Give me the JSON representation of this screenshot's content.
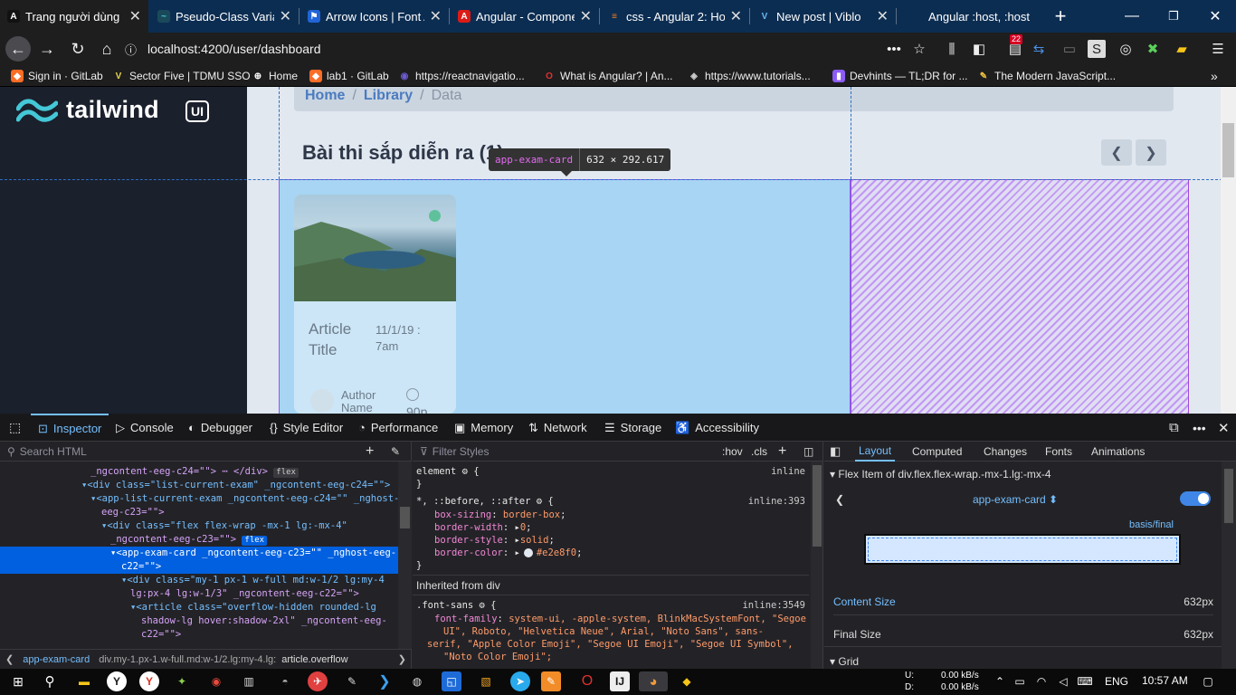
{
  "browser": {
    "tabs": [
      {
        "label": "Trang người dùng",
        "icon": "A",
        "icon_bg": "#111",
        "icon_fg": "#fff",
        "active": true
      },
      {
        "label": "Pseudo-Class Variar",
        "icon": "~",
        "icon_bg": "#1a4a5a",
        "icon_fg": "#44c7d6"
      },
      {
        "label": "Arrow Icons | Font A",
        "icon": "⚑",
        "icon_bg": "#2064d8",
        "icon_fg": "#fff"
      },
      {
        "label": "Angular - Compone",
        "icon": "A",
        "icon_bg": "#dd1b16",
        "icon_fg": "#fff"
      },
      {
        "label": "css - Angular 2: Hov",
        "icon": "≡",
        "icon_bg": "#0c2d52",
        "icon_fg": "#f48024"
      },
      {
        "label": "New post | Viblo",
        "icon": "V",
        "icon_bg": "#0c2d52",
        "icon_fg": "#68b8f0"
      },
      {
        "label": "Angular :host, :host",
        "icon": "",
        "icon_bg": "#0c2d52",
        "icon_fg": "#fff"
      }
    ],
    "url": "localhost:4200/user/dashboard",
    "notif_count": "22",
    "bookmarks": [
      {
        "label": "Sign in · GitLab",
        "color": "#fc6d26"
      },
      {
        "label": "Sector Five | TDMU SSO",
        "color": "#e8d44d"
      },
      {
        "label": "Home",
        "color": "#ffffff"
      },
      {
        "label": "lab1 · GitLab",
        "color": "#fc6d26"
      },
      {
        "label": "https://reactnavigatio...",
        "color": "#6b5bd6"
      },
      {
        "label": "What is Angular? | An...",
        "color": "#e03030"
      },
      {
        "label": "https://www.tutorials...",
        "color": "#cccccc"
      },
      {
        "label": "Devhints — TL;DR for ...",
        "color": "#8b5cf6"
      },
      {
        "label": "The Modern JavaScript...",
        "color": "#f0c040"
      }
    ]
  },
  "page": {
    "logo": "tailwind",
    "logo_badge": "UI",
    "breadcrumb": {
      "home": "Home",
      "library": "Library",
      "current": "Data"
    },
    "section_title": "Bài thi sắp diễn ra (1)",
    "card": {
      "title": "Article Title",
      "date": "11/1/19 : 7am",
      "author": "Author Name",
      "time": "90p"
    },
    "tooltip": {
      "name": "app-exam-card",
      "size": "632 × 292.617"
    }
  },
  "devtools": {
    "tabs": [
      {
        "label": "Inspector",
        "icon": "⊡",
        "active": true
      },
      {
        "label": "Console",
        "icon": "▷"
      },
      {
        "label": "Debugger",
        "icon": "◐"
      },
      {
        "label": "Style Editor",
        "icon": "{}"
      },
      {
        "label": "Performance",
        "icon": "◔"
      },
      {
        "label": "Memory",
        "icon": "▣"
      },
      {
        "label": "Network",
        "icon": "⇅"
      },
      {
        "label": "Storage",
        "icon": "☰"
      },
      {
        "label": "Accessibility",
        "icon": "♿"
      }
    ],
    "search_placeholder": "Search HTML",
    "filter_placeholder": "Filter Styles",
    "hov": ":hov",
    "cls": ".cls",
    "html_lines": [
      "_ngcontent-eeg-c24=\"\"> ⋯ </div>",
      "<div class=\"list-current-exam\" _ngcontent-eeg-c24=\"\">",
      "<app-list-current-exam _ngcontent-eeg-c24=\"\" _nghost-",
      "eeg-c23=\"\">",
      "<div class=\"flex flex-wrap -mx-1 lg:-mx-4\"",
      "_ngcontent-eeg-c23=\"\">",
      "<app-exam-card _ngcontent-eeg-c23=\"\" _nghost-eeg-",
      "c22=\"\">",
      "<div class=\"my-1 px-1 w-full md:w-1/2 lg:my-4",
      "lg:px-4 lg:w-1/3\" _ngcontent-eeg-c22=\"\">",
      "<article class=\"overflow-hidden rounded-lg",
      "shadow-lg hover:shadow-2xl\" _ngcontent-eeg-",
      "c22=\"\">"
    ],
    "badge_flex": "flex",
    "html_breadcrumb": [
      "app-exam-card",
      "div.my-1.px-1.w-full.md:w-1/2.lg:my-4.lg:",
      "article.overflow"
    ],
    "rules": {
      "element_sel": "element",
      "element_src": "inline",
      "universal_sel": "*, ::before, ::after",
      "universal_src": "inline:393",
      "props": [
        {
          "name": "box-sizing",
          "value": "border-box"
        },
        {
          "name": "border-width",
          "value": "0"
        },
        {
          "name": "border-style",
          "value": "solid"
        },
        {
          "name": "border-color",
          "value": "#e2e8f0"
        }
      ],
      "inherited": "Inherited from div",
      "font_sel": ".font-sans",
      "font_src": "inline:3549",
      "font_prop": "font-family",
      "font_value_lines": [
        "system-ui, -apple-system, BlinkMacSystemFont, \"Segoe",
        "UI\", Roboto, \"Helvetica Neue\", Arial, \"Noto Sans\", sans-",
        "serif, \"Apple Color Emoji\", \"Segoe UI Emoji\", \"Segoe UI Symbol\",",
        "\"Noto Color Emoji\";"
      ]
    },
    "layout": {
      "tabs": [
        "Layout",
        "Computed",
        "Changes",
        "Fonts",
        "Animations"
      ],
      "flex_item_header": "Flex Item of div.flex.flex-wrap.-mx-1.lg:-mx-4",
      "selected": "app-exam-card",
      "basis_label": "basis/final",
      "content_size_label": "Content Size",
      "content_size": "632px",
      "final_size_label": "Final Size",
      "final_size": "632px",
      "grid_label": "Grid"
    }
  },
  "taskbar": {
    "net_up_label": "U:",
    "net_up": "0.00 kB/s",
    "net_down_label": "D:",
    "net_down": "0.00 kB/s",
    "lang": "ENG",
    "clock": "10:57 AM"
  }
}
